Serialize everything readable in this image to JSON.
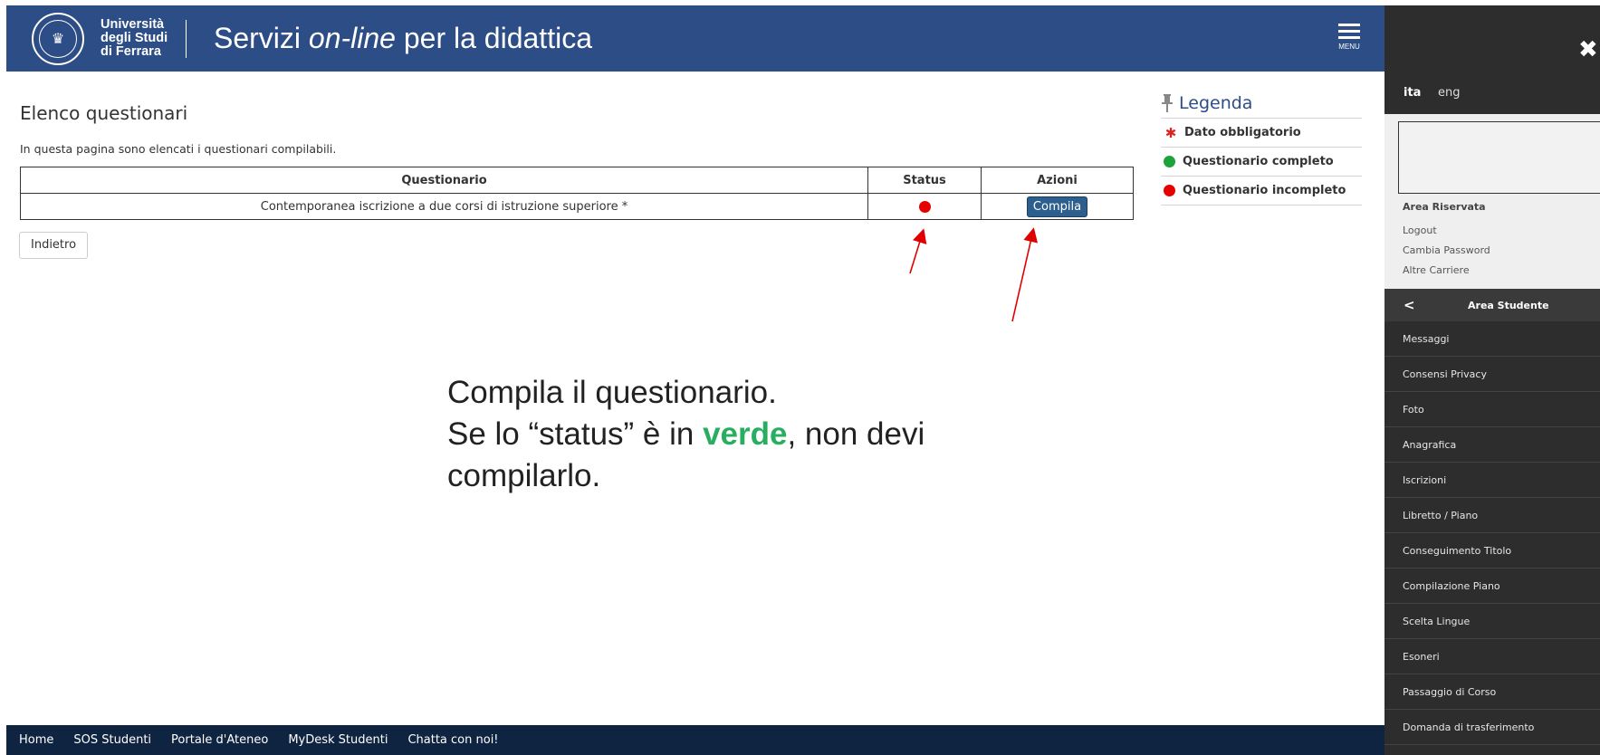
{
  "header": {
    "uni_line1": "Università",
    "uni_line2": "degli Studi",
    "uni_line3": "di Ferrara",
    "title_prefix": "Servizi ",
    "title_italic": "on-line",
    "title_suffix": " per la didattica",
    "menu_label": "MENU"
  },
  "main": {
    "title": "Elenco questionari",
    "description": "In questa pagina sono elencati i questionari compilabili.",
    "table": {
      "headers": [
        "Questionario",
        "Status",
        "Azioni"
      ],
      "rows": [
        {
          "questionario": "Contemporanea iscrizione a due corsi di istruzione superiore *",
          "status": "incompleto",
          "status_color": "#e60000",
          "action": "Compila"
        }
      ]
    },
    "back_button": "Indietro"
  },
  "legend": {
    "title": "Legenda",
    "items": [
      {
        "label": "Dato obbligatorio",
        "icon": "asterisk-icon",
        "color": "#d9261c"
      },
      {
        "label": "Questionario completo",
        "icon": "green-dot-icon",
        "color": "#1ea23a"
      },
      {
        "label": "Questionario incompleto",
        "icon": "red-dot-icon",
        "color": "#e60000"
      }
    ]
  },
  "annotation": {
    "line1": "Compila il questionario.",
    "line2_before": "Se lo “status” è in ",
    "line2_highlight": "verde",
    "line2_after": ", non devi",
    "line3": "compilarlo.",
    "highlight_color": "#27ae60",
    "arrow_color": "#e00000"
  },
  "footer": {
    "links": [
      "Home",
      "SOS Studenti",
      "Portale d'Ateneo",
      "MyDesk Studenti",
      "Chatta con noi!"
    ]
  },
  "side_panel": {
    "lang_ita": "ita",
    "lang_eng": "eng",
    "reserved_title": "Area Riservata",
    "reserved_links": [
      "Logout",
      "Cambia Password",
      "Altre Carriere"
    ],
    "area_title": "Area Studente",
    "items": [
      "Messaggi",
      "Consensi Privacy",
      "Foto",
      "Anagrafica",
      "Iscrizioni",
      "Libretto / Piano",
      "Conseguimento Titolo",
      "Compilazione Piano",
      "Scelta Lingue",
      "Esoneri",
      "Passaggio di Corso",
      "Domanda di trasferimento"
    ]
  },
  "colors": {
    "header_bg": "#2c4d85",
    "footer_bg": "#0f2440",
    "sidebar_bg": "#2d2d2d",
    "button_blue": "#2c5f8e"
  }
}
